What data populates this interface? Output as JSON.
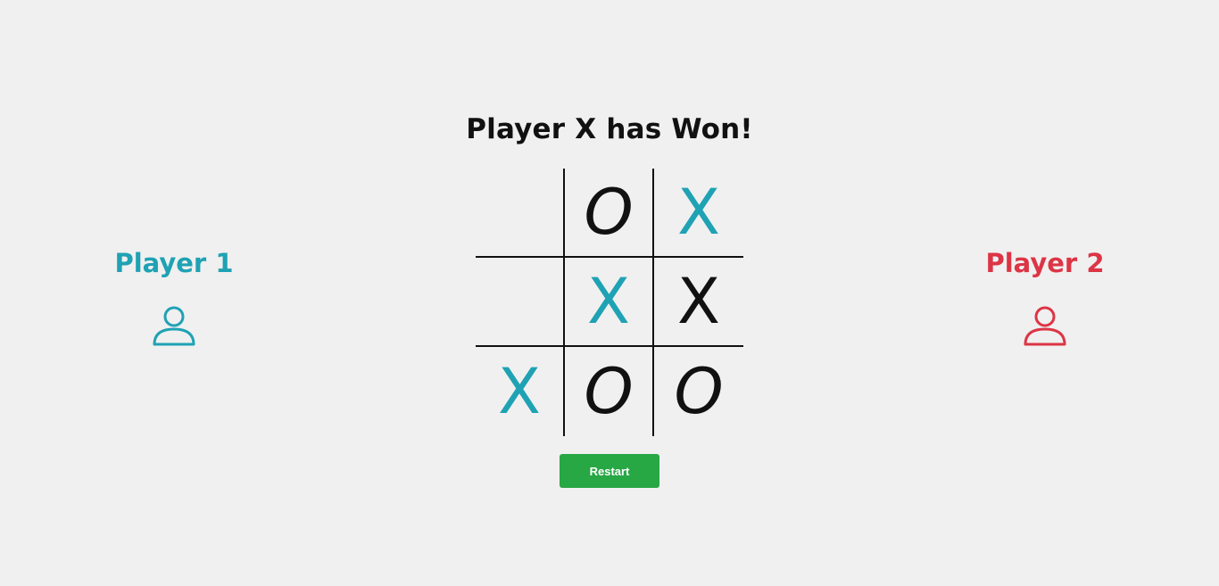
{
  "status": "Player X has Won!",
  "colors": {
    "player1": "#1ea2b4",
    "player2": "#dc3545",
    "mark_default": "#111111",
    "restart_bg": "#28a745"
  },
  "board": {
    "cells": [
      {
        "mark": "",
        "highlight": false
      },
      {
        "mark": "O",
        "highlight": false
      },
      {
        "mark": "X",
        "highlight": true
      },
      {
        "mark": "",
        "highlight": false
      },
      {
        "mark": "X",
        "highlight": true
      },
      {
        "mark": "X",
        "highlight": false
      },
      {
        "mark": "X",
        "highlight": true
      },
      {
        "mark": "O",
        "highlight": false
      },
      {
        "mark": "O",
        "highlight": false
      }
    ]
  },
  "restart_label": "Restart",
  "players": {
    "p1": {
      "label": "Player 1",
      "icon": "user-icon"
    },
    "p2": {
      "label": "Player 2",
      "icon": "user-icon"
    }
  }
}
